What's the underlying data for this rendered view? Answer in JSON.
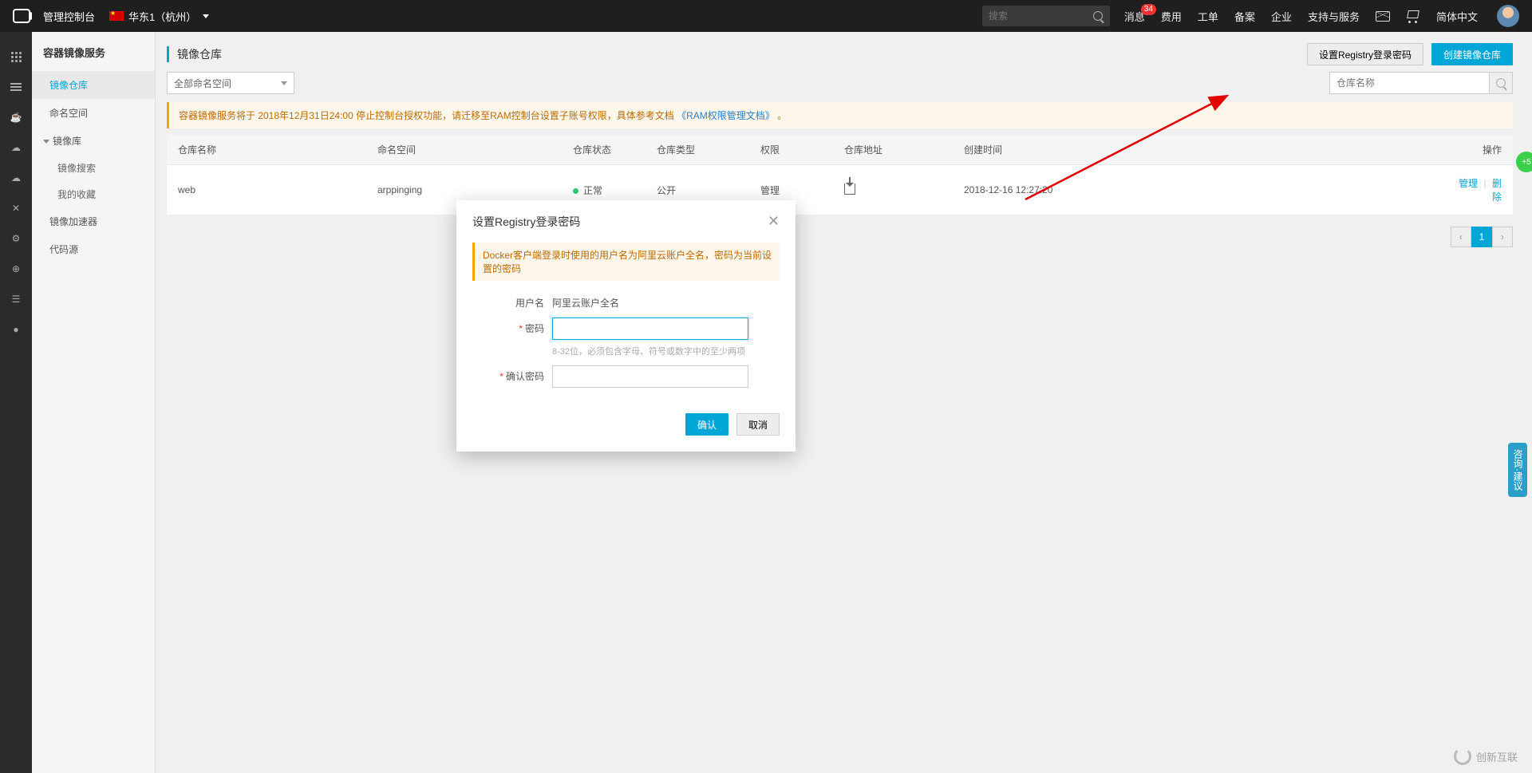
{
  "header": {
    "console": "管理控制台",
    "region": "华东1（杭州）",
    "search_placeholder": "搜索",
    "nav": {
      "messages": "消息",
      "messages_badge": "34",
      "fees": "费用",
      "workorder": "工单",
      "record": "备案",
      "enterprise": "企业",
      "support": "支持与服务",
      "language": "简体中文"
    }
  },
  "sidebar": {
    "service": "容器镜像服务",
    "items": {
      "repos": "镜像仓库",
      "namespaces": "命名空间",
      "group_images": "镜像库",
      "sub_search": "镜像搜索",
      "sub_fav": "我的收藏",
      "accelerator": "镜像加速器",
      "code": "代码源"
    }
  },
  "page": {
    "title": "镜像仓库",
    "btn_set_pw": "设置Registry登录密码",
    "btn_create": "创建镜像仓库",
    "namespace_dropdown": "全部命名空间",
    "search_placeholder": "仓库名称",
    "notice_pre": "容器镜像服务将于 2018年12月31日24:00 停止控制台授权功能，请迁移至RAM控制台设置子账号权限，具体参考文档",
    "notice_link": "《RAM权限管理文档》",
    "notice_suf": "。"
  },
  "table": {
    "headers": {
      "name": "仓库名称",
      "ns": "命名空间",
      "status": "仓库状态",
      "type": "仓库类型",
      "perm": "权限",
      "addr": "仓库地址",
      "created": "创建时间",
      "op": "操作"
    },
    "row": {
      "name": "web",
      "ns": "arppinging",
      "status": "正常",
      "type": "公开",
      "perm": "管理",
      "created": "2018-12-16 12:27:20",
      "op_manage": "管理",
      "op_delete": "删除"
    },
    "page": "1"
  },
  "modal": {
    "title": "设置Registry登录密码",
    "notice": "Docker客户端登录时使用的用户名为阿里云账户全名，密码为当前设置的密码",
    "label_user": "用户名",
    "value_user": "阿里云账户全名",
    "label_pw": "密码",
    "hint_pw": "8-32位，必须包含字母、符号或数字中的至少两项",
    "label_confirm": "确认密码",
    "btn_ok": "确认",
    "btn_cancel": "取消"
  },
  "float": {
    "badge": "+5",
    "panel": "咨询·建议"
  },
  "watermark": "创新互联"
}
